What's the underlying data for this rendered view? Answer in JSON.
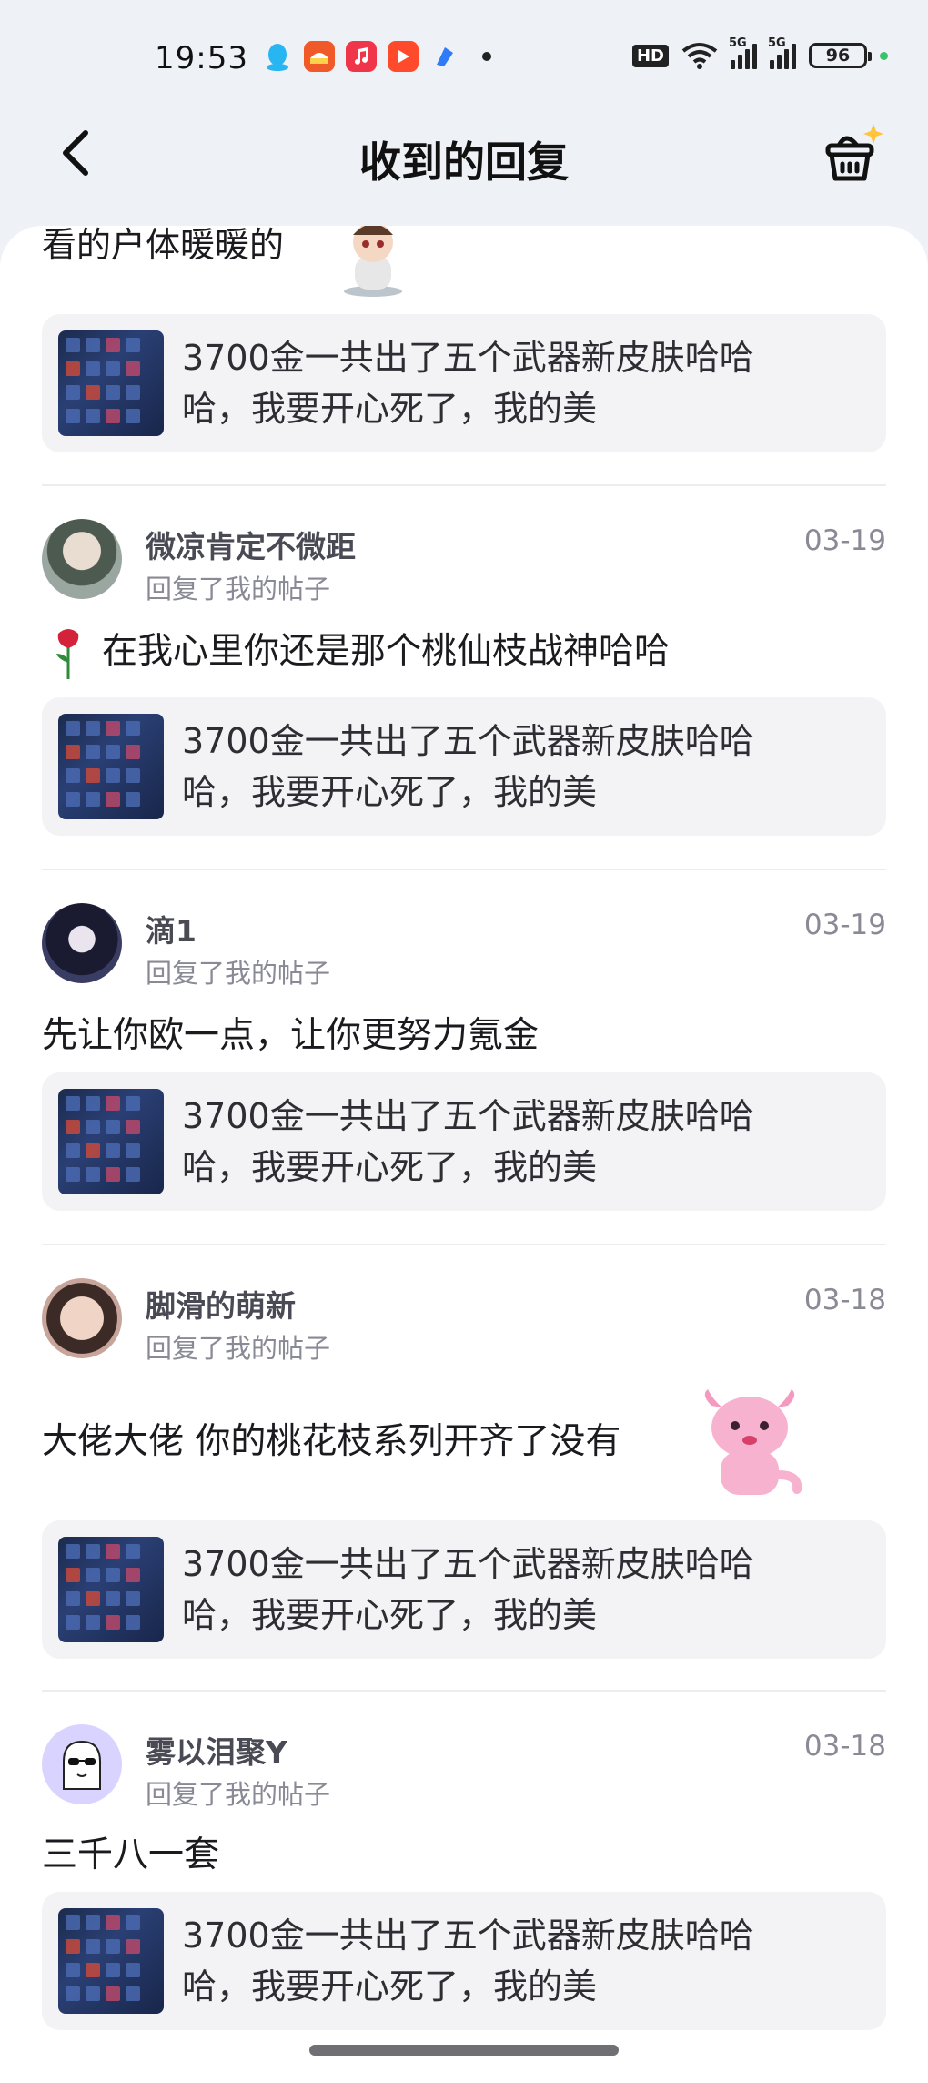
{
  "status_bar": {
    "time": "19:53",
    "hd_label": "HD",
    "signal_1_label": "5G",
    "signal_2_label": "5G",
    "battery": "96"
  },
  "nav": {
    "title": "收到的回复",
    "back_icon": "chevron-left-icon",
    "right_icon": "basket-sparkle-icon"
  },
  "top_partial": {
    "text": "看的户体暖暖的"
  },
  "quoted_post": "3700金一共出了五个武器新皮肤哈哈哈，我要开心死了，我的美",
  "replies": [
    {
      "user": "微凉肯定不微距",
      "sub": "回复了我的帖子",
      "date": "03-19",
      "text": "在我心里你还是那个桃仙枝战神哈哈",
      "quote": "3700金一共出了五个武器新皮肤哈哈哈，我要开心死了，我的美"
    },
    {
      "user": "滴1",
      "sub": "回复了我的帖子",
      "date": "03-19",
      "text": "先让你欧一点，让你更努力氪金",
      "quote": "3700金一共出了五个武器新皮肤哈哈哈，我要开心死了，我的美"
    },
    {
      "user": "脚滑的萌新",
      "sub": "回复了我的帖子",
      "date": "03-18",
      "text": "大佬大佬   你的桃花枝系列开齐了没有",
      "quote": "3700金一共出了五个武器新皮肤哈哈哈，我要开心死了，我的美"
    },
    {
      "user": "雾以泪聚Y",
      "sub": "回复了我的帖子",
      "date": "03-18",
      "text": "三千八一套",
      "quote": "3700金一共出了五个武器新皮肤哈哈哈，我要开心死了，我的美"
    }
  ],
  "quote_lines": [
    "3700金一共出了五个武器新皮肤哈哈",
    "哈，我要开心死了，我的美"
  ]
}
